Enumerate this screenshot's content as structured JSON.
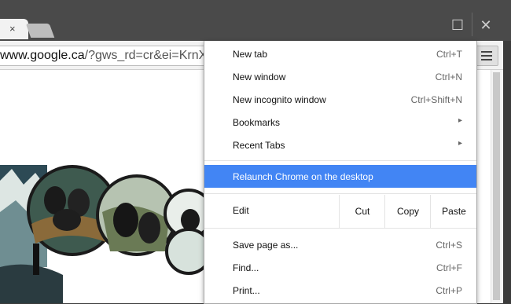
{
  "window": {
    "tab_close": "×",
    "maximize_icon": "☐",
    "close_icon": "✕"
  },
  "toolbar": {
    "url_host": "www.google.ca",
    "url_rest": "/?gws_rd=cr&ei=KrnX"
  },
  "menu": {
    "items": [
      {
        "label": "New tab",
        "shortcut": "Ctrl+T"
      },
      {
        "label": "New window",
        "shortcut": "Ctrl+N"
      },
      {
        "label": "New incognito window",
        "shortcut": "Ctrl+Shift+N"
      },
      {
        "label": "Bookmarks",
        "arrow": "▸"
      },
      {
        "label": "Recent Tabs",
        "arrow": "▸"
      }
    ],
    "relaunch": "Relaunch Chrome on the desktop",
    "edit": {
      "label": "Edit",
      "cut": "Cut",
      "copy": "Copy",
      "paste": "Paste"
    },
    "items2": [
      {
        "label": "Save page as...",
        "shortcut": "Ctrl+S"
      },
      {
        "label": "Find...",
        "shortcut": "Ctrl+F"
      },
      {
        "label": "Print...",
        "shortcut": "Ctrl+P"
      }
    ],
    "highlight_color": "#4285f4"
  }
}
